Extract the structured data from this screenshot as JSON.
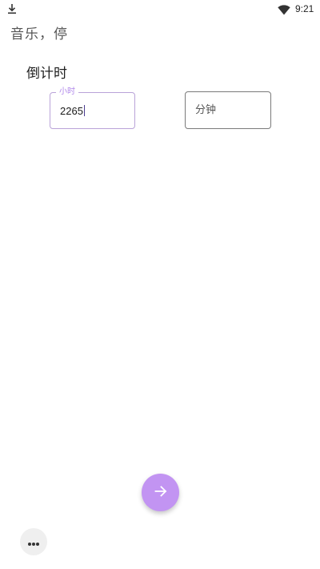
{
  "status_bar": {
    "time": "9:21",
    "left_icon": "download-icon",
    "right_icon": "wifi-icon"
  },
  "app": {
    "title": "音乐，停"
  },
  "timer": {
    "heading": "倒计时",
    "hours_field": {
      "label": "小时",
      "value": "2265"
    },
    "minutes_field": {
      "placeholder": "分钟",
      "value": ""
    }
  },
  "fab": {
    "icon": "arrow-right-icon"
  },
  "more": {
    "icon": "more-horizontal-icon"
  },
  "colors": {
    "accent": "#c294f2",
    "focused_border": "#b9a3d8",
    "label": "#b088ea"
  }
}
